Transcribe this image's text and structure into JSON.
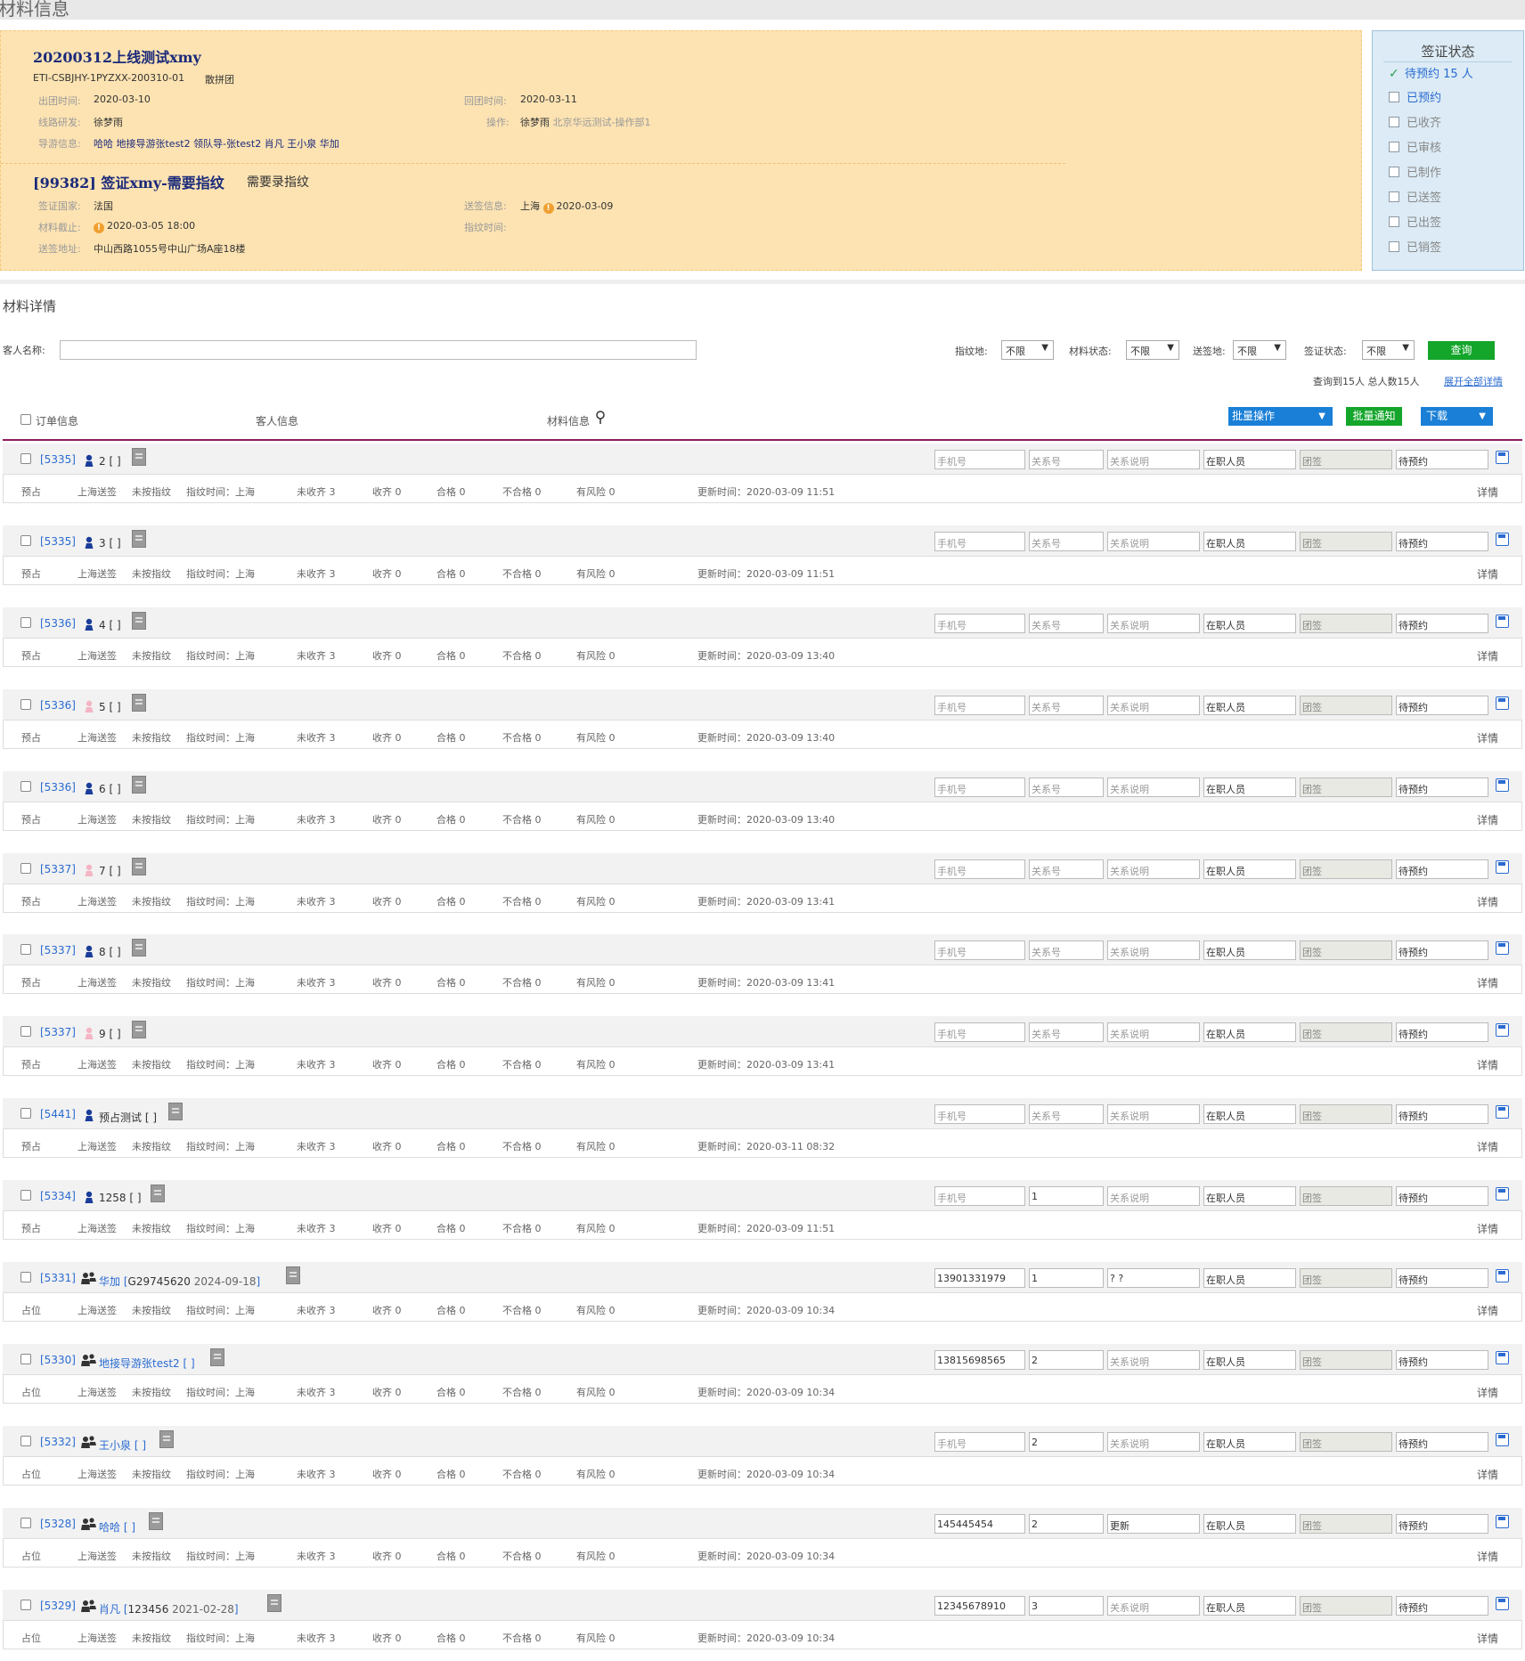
{
  "page_title": "材料信息",
  "order": {
    "title": "20200312上线测试xmy",
    "code": "ETI-CSBJHY-1PYZXX-200310-01",
    "type": "散拼团",
    "depart_label": "出团时间:",
    "depart": "2020-03-10",
    "return_label": "回团时间:",
    "return": "2020-03-11",
    "dev_label": "线路研发:",
    "dev": "徐梦雨",
    "op_label": "操作:",
    "op_name": "徐梦雨",
    "op_dept": "北京华远测试-操作部1",
    "guide_label": "导游信息:",
    "guide": "哈哈 地接导游张test2 领队导-张test2 肖凡 王小泉 华加"
  },
  "visa": {
    "title": "[99382] 签证xmy-需要指纹",
    "note": "需要录指纹",
    "country_label": "签证国家:",
    "country": "法国",
    "deliver_label": "送签信息:",
    "deliver_city": "上海",
    "deliver_date": "2020-03-09",
    "deadline_label": "材料截止:",
    "deadline": "2020-03-05 18:00",
    "finger_label": "指纹时间:",
    "finger": "",
    "address_label": "送签地址:",
    "address": "中山西路1055号中山广场A座18楼"
  },
  "visa_status": {
    "title": "签证状态",
    "items": [
      {
        "label": "待预约 15 人"
      },
      {
        "label": "已预约"
      },
      {
        "label": "已收齐"
      },
      {
        "label": "已审核"
      },
      {
        "label": "已制作"
      },
      {
        "label": "已送签"
      },
      {
        "label": "已出签"
      },
      {
        "label": "已销签"
      }
    ]
  },
  "material": {
    "title": "材料详情",
    "name_label": "客人名称:",
    "filters": [
      {
        "label": "指纹地:",
        "value": "不限"
      },
      {
        "label": "材料状态:",
        "value": "不限"
      },
      {
        "label": "送签地:",
        "value": "不限"
      },
      {
        "label": "签证状态:",
        "value": "不限"
      }
    ],
    "query_btn": "查询",
    "result": "查询到15人 总人数15人",
    "expand": "展开全部详情"
  },
  "table": {
    "col_order": "订单信息",
    "col_guest": "客人信息",
    "col_material": "材料信息",
    "batch_op": "批量操作",
    "batch_notice": "批量通知",
    "download": "下载"
  },
  "row_static": {
    "phone_ph": "手机号",
    "relation_ph": "关系号",
    "relation_desc_ph": "关系说明",
    "occupation": "在职人员",
    "group_visa": "团签",
    "visa_state": "待预约",
    "deliver": "上海送签",
    "finger": "未按指纹",
    "finger_time": "指纹时间：上海",
    "missing": "未收齐 3",
    "received": "收齐 0",
    "pass": "合格 0",
    "fail": "不合格 0",
    "risk": "有风险 0",
    "detail": "详情",
    "update_label": "更新时间："
  },
  "rows": [
    {
      "order": "[5335]",
      "icon": "male",
      "name": "2",
      "passport": "",
      "date": "",
      "phone": "",
      "relation": "",
      "relation_desc": "",
      "kind": "预占",
      "updated": "2020-03-09 11:51"
    },
    {
      "order": "[5335]",
      "icon": "male",
      "name": "3",
      "passport": "",
      "date": "",
      "phone": "",
      "relation": "",
      "relation_desc": "",
      "kind": "预占",
      "updated": "2020-03-09 11:51"
    },
    {
      "order": "[5336]",
      "icon": "male",
      "name": "4",
      "passport": "",
      "date": "",
      "phone": "",
      "relation": "",
      "relation_desc": "",
      "kind": "预占",
      "updated": "2020-03-09 13:40"
    },
    {
      "order": "[5336]",
      "icon": "female",
      "name": "5",
      "passport": "",
      "date": "",
      "phone": "",
      "relation": "",
      "relation_desc": "",
      "kind": "预占",
      "updated": "2020-03-09 13:40"
    },
    {
      "order": "[5336]",
      "icon": "male",
      "name": "6",
      "passport": "",
      "date": "",
      "phone": "",
      "relation": "",
      "relation_desc": "",
      "kind": "预占",
      "updated": "2020-03-09 13:40"
    },
    {
      "order": "[5337]",
      "icon": "female",
      "name": "7",
      "passport": "",
      "date": "",
      "phone": "",
      "relation": "",
      "relation_desc": "",
      "kind": "预占",
      "updated": "2020-03-09 13:41"
    },
    {
      "order": "[5337]",
      "icon": "male",
      "name": "8",
      "passport": "",
      "date": "",
      "phone": "",
      "relation": "",
      "relation_desc": "",
      "kind": "预占",
      "updated": "2020-03-09 13:41"
    },
    {
      "order": "[5337]",
      "icon": "female",
      "name": "9",
      "passport": "",
      "date": "",
      "phone": "",
      "relation": "",
      "relation_desc": "",
      "kind": "预占",
      "updated": "2020-03-09 13:41"
    },
    {
      "order": "[5441]",
      "icon": "male",
      "name": "预占测试",
      "passport": "",
      "date": "",
      "phone": "",
      "relation": "",
      "relation_desc": "",
      "kind": "预占",
      "updated": "2020-03-11 08:32"
    },
    {
      "order": "[5334]",
      "icon": "male",
      "name": "1258",
      "passport": "",
      "date": "",
      "phone": "",
      "relation": "1",
      "relation_desc": "",
      "kind": "预占",
      "updated": "2020-03-09 11:51"
    },
    {
      "order": "[5331]",
      "icon": "group",
      "name": "华加",
      "passport": "G29745620",
      "date": "2024-09-18",
      "phone": "13901331979",
      "relation": "1",
      "relation_desc": "? ?",
      "kind": "占位",
      "updated": "2020-03-09 10:34"
    },
    {
      "order": "[5330]",
      "icon": "group",
      "name": "地接导游张test2",
      "passport": "",
      "date": "",
      "phone": "13815698565",
      "relation": "2",
      "relation_desc": "",
      "kind": "占位",
      "updated": "2020-03-09 10:34"
    },
    {
      "order": "[5332]",
      "icon": "group",
      "name": "王小泉",
      "passport": "",
      "date": "",
      "phone": "",
      "relation": "2",
      "relation_desc": "",
      "kind": "占位",
      "updated": "2020-03-09 10:34"
    },
    {
      "order": "[5328]",
      "icon": "group",
      "name": "哈哈",
      "passport": "",
      "date": "",
      "phone": "145445454",
      "relation": "2",
      "relation_desc": "更新",
      "kind": "占位",
      "updated": "2020-03-09 10:34"
    },
    {
      "order": "[5329]",
      "icon": "group",
      "name": "肖凡",
      "passport": "123456",
      "date": "2021-02-28",
      "phone": "12345678910",
      "relation": "3",
      "relation_desc": "",
      "kind": "占位",
      "updated": "2020-03-09 10:34"
    }
  ]
}
